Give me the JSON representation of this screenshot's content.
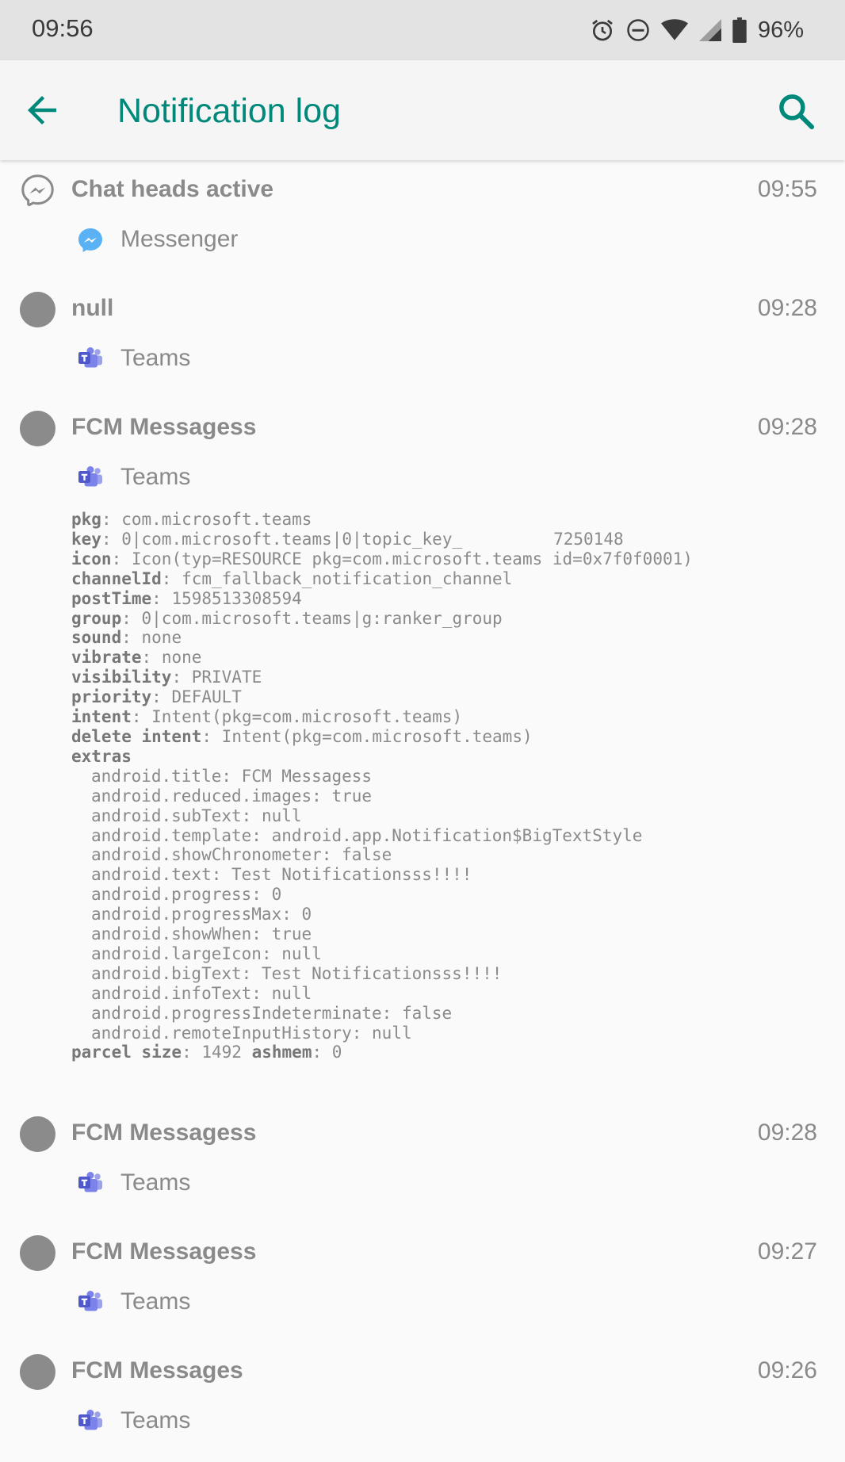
{
  "status_bar": {
    "time": "09:56",
    "battery": "96%",
    "icons": [
      "alarm-icon",
      "do-not-disturb-icon",
      "wifi-icon",
      "signal-icon",
      "battery-icon"
    ]
  },
  "app_bar": {
    "title": "Notification log",
    "accent_color": "#00897b"
  },
  "notifications": [
    {
      "title": "Chat heads active",
      "time": "09:55",
      "app": "Messenger",
      "icon": "messenger-icon"
    },
    {
      "title": "null",
      "time": "09:28",
      "app": "Teams",
      "icon": "teams-icon"
    },
    {
      "title": "FCM Messagess",
      "time": "09:28",
      "app": "Teams",
      "icon": "teams-icon"
    },
    {
      "title": "FCM Messagess",
      "time": "09:28",
      "app": "Teams",
      "icon": "teams-icon"
    },
    {
      "title": "FCM Messagess",
      "time": "09:27",
      "app": "Teams",
      "icon": "teams-icon"
    },
    {
      "title": "FCM Messages",
      "time": "09:26",
      "app": "Teams",
      "icon": "teams-icon"
    }
  ],
  "details": {
    "pkg": {
      "label": "pkg",
      "value": "com.microsoft.teams"
    },
    "key": {
      "label": "key",
      "value_start": "0|com.microsoft.teams|0|topic_key_",
      "value_end": "7250148"
    },
    "icon": {
      "label": "icon",
      "value": "Icon(typ=RESOURCE pkg=com.microsoft.teams id=0x7f0f0001)"
    },
    "channelId": {
      "label": "channelId",
      "value": "fcm_fallback_notification_channel"
    },
    "postTime": {
      "label": "postTime",
      "value": "1598513308594"
    },
    "group": {
      "label": "group",
      "value": "0|com.microsoft.teams|g:ranker_group"
    },
    "sound": {
      "label": "sound",
      "value": "none"
    },
    "vibrate": {
      "label": "vibrate",
      "value": "none"
    },
    "visibility": {
      "label": "visibility",
      "value": "PRIVATE"
    },
    "priority": {
      "label": "priority",
      "value": "DEFAULT"
    },
    "intent": {
      "label": "intent",
      "value": "Intent(pkg=com.microsoft.teams)"
    },
    "delete_intent": {
      "label": "delete intent",
      "value": "Intent(pkg=com.microsoft.teams)"
    },
    "extras_label": "extras",
    "extras": [
      {
        "key": "android.title",
        "value": "FCM Messagess"
      },
      {
        "key": "android.reduced.images",
        "value": "true"
      },
      {
        "key": "android.subText",
        "value": "null"
      },
      {
        "key": "android.template",
        "value": "android.app.Notification$BigTextStyle"
      },
      {
        "key": "android.showChronometer",
        "value": "false"
      },
      {
        "key": "android.text",
        "value": "Test Notificationsss!!!!"
      },
      {
        "key": "android.progress",
        "value": "0"
      },
      {
        "key": "android.progressMax",
        "value": "0"
      },
      {
        "key": "android.showWhen",
        "value": "true"
      },
      {
        "key": "android.largeIcon",
        "value": "null"
      },
      {
        "key": "android.bigText",
        "value": "Test Notificationsss!!!!"
      },
      {
        "key": "android.infoText",
        "value": "null"
      },
      {
        "key": "android.progressIndeterminate",
        "value": "false"
      },
      {
        "key": "android.remoteInputHistory",
        "value": "null"
      }
    ],
    "parcel_size": {
      "label": "parcel size",
      "value": "1492"
    },
    "ashmem": {
      "label": "ashmem",
      "value": "0"
    }
  }
}
